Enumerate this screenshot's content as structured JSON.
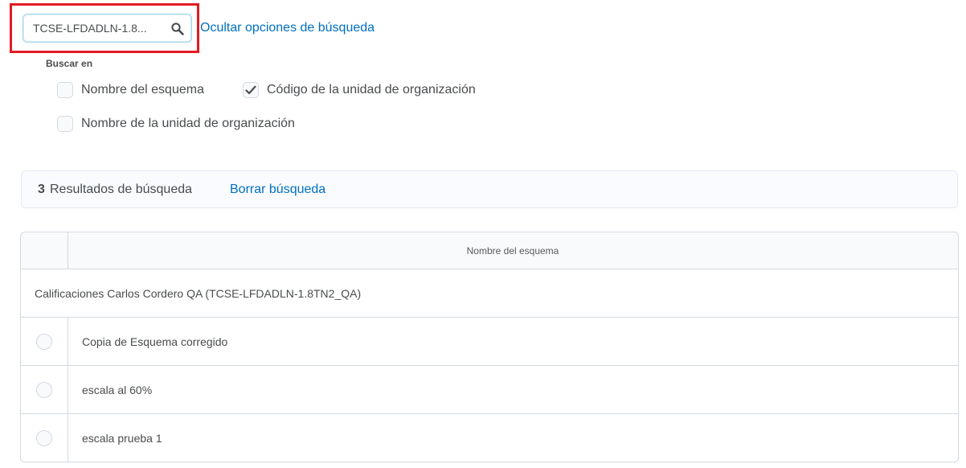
{
  "search": {
    "value": "TCSE-LFDADLN-1.8...",
    "icon": "search-icon",
    "toggle_link": "Ocultar opciones de búsqueda",
    "highlight_color": "#e31b23"
  },
  "search_in": {
    "label": "Buscar en",
    "options": [
      {
        "label": "Nombre del esquema",
        "checked": false
      },
      {
        "label": "Código de la unidad de organización",
        "checked": true
      },
      {
        "label": "Nombre de la unidad de organización",
        "checked": false
      }
    ]
  },
  "results": {
    "count": "3",
    "text": "Resultados de búsqueda",
    "clear_link": "Borrar búsqueda"
  },
  "table": {
    "header": "Nombre del esquema",
    "group": "Calificaciones Carlos Cordero QA (TCSE-LFDADLN-1.8TN2_QA)",
    "rows": [
      {
        "name": "Copia de Esquema corregido"
      },
      {
        "name": "escala al 60%"
      },
      {
        "name": "escala prueba 1"
      }
    ]
  },
  "colors": {
    "link": "#006fbf",
    "text": "#494c4e",
    "border": "#d3d9e3"
  }
}
